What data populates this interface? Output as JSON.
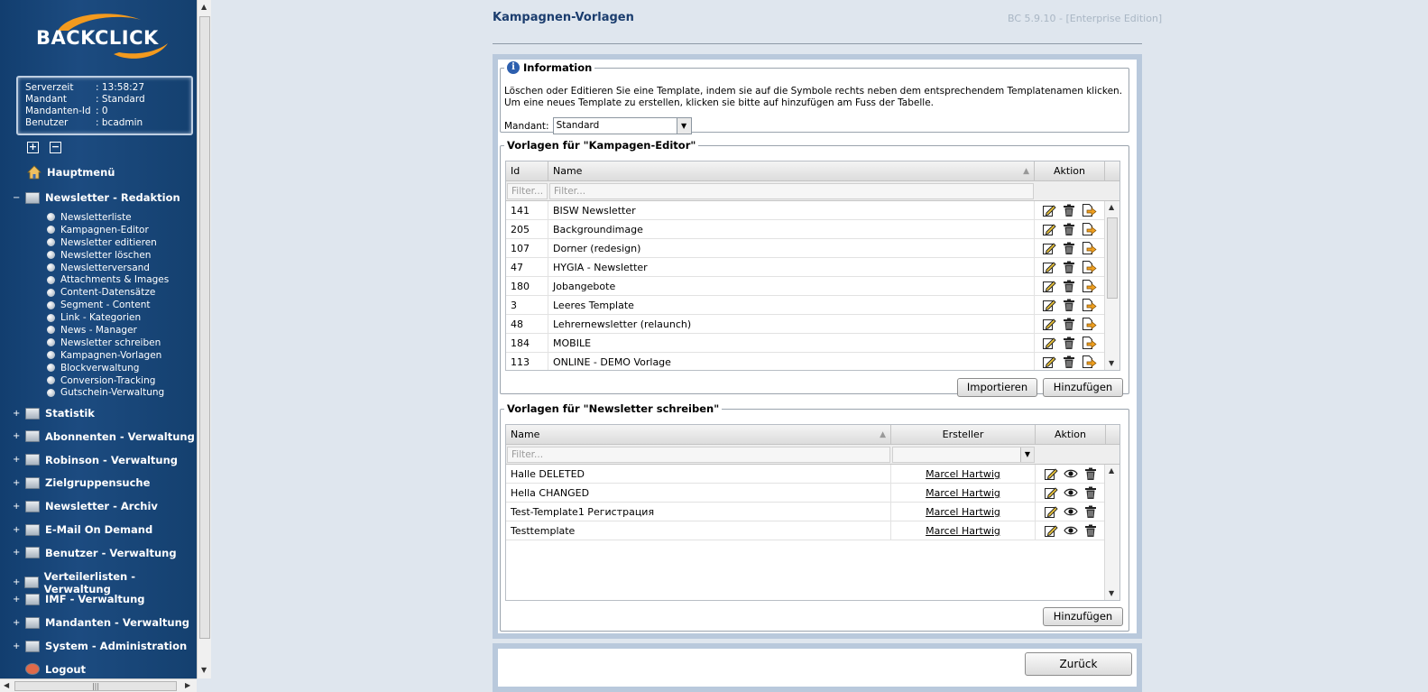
{
  "brand": {
    "logo_text": "BACKCLICK"
  },
  "server_info": [
    {
      "key": "Serverzeit",
      "value": ": 13:58:27"
    },
    {
      "key": "Mandant",
      "value": ": Standard"
    },
    {
      "key": "Mandanten-Id",
      "value": ": 0"
    },
    {
      "key": "Benutzer",
      "value": ": bcadmin"
    }
  ],
  "sidebar": {
    "expand_all": "+",
    "collapse_all": "−",
    "main_menu": "Hauptmenü",
    "open_section": {
      "toggle": "−",
      "label": "Newsletter - Redaktion"
    },
    "sub_items": [
      "Newsletterliste",
      "Kampagnen-Editor",
      "Newsletter editieren",
      "Newsletter löschen",
      "Newsletterversand",
      "Attachments & Images",
      "Content-Datensätze",
      "Segment - Content",
      "Link - Kategorien",
      "News - Manager",
      "Newsletter schreiben",
      "Kampagnen-Vorlagen",
      "Blockverwaltung",
      "Conversion-Tracking",
      "Gutschein-Verwaltung"
    ],
    "sections": [
      "Statistik",
      "Abonnenten - Verwaltung",
      "Robinson - Verwaltung",
      "Zielgruppensuche",
      "Newsletter - Archiv",
      "E-Mail On Demand",
      "Benutzer - Verwaltung",
      "Verteilerlisten - Verwaltung",
      "IMF - Verwaltung",
      "Mandanten - Verwaltung",
      "System - Administration",
      "Logout"
    ],
    "section_toggle": "+"
  },
  "header": {
    "title": "Kampagnen-Vorlagen",
    "version": "BC 5.9.10 - [Enterprise Edition]"
  },
  "information": {
    "legend": "Information",
    "icon_glyph": "i",
    "line1": "Löschen oder Editieren Sie eine Template, indem sie auf die Symbole rechts neben dem entsprechendem Templatenamen klicken.",
    "line2": "Um eine neues Template zu erstellen, klicken sie bitte auf hinzufügen am Fuss der Tabelle.",
    "mandant_label": "Mandant:",
    "mandant_value": "Standard"
  },
  "editor_templates": {
    "legend": "Vorlagen für \"Kampagen-Editor\"",
    "columns": {
      "id": "Id",
      "name": "Name",
      "action": "Aktion"
    },
    "filter_placeholder": "Filter...",
    "rows": [
      {
        "id": "141",
        "name": "BISW Newsletter"
      },
      {
        "id": "205",
        "name": "Backgroundimage"
      },
      {
        "id": "107",
        "name": "Dorner (redesign)"
      },
      {
        "id": "47",
        "name": "HYGIA - Newsletter"
      },
      {
        "id": "180",
        "name": "Jobangebote"
      },
      {
        "id": "3",
        "name": "Leeres Template"
      },
      {
        "id": "48",
        "name": "Lehrernewsletter (relaunch)"
      },
      {
        "id": "184",
        "name": "MOBILE"
      },
      {
        "id": "113",
        "name": "ONLINE - DEMO Vorlage"
      }
    ],
    "import_button": "Importieren",
    "add_button": "Hinzufügen"
  },
  "writer_templates": {
    "legend": "Vorlagen für \"Newsletter schreiben\"",
    "columns": {
      "name": "Name",
      "creator": "Ersteller",
      "action": "Aktion"
    },
    "filter_placeholder": "Filter...",
    "rows": [
      {
        "name": "Halle DELETED",
        "creator": "Marcel Hartwig"
      },
      {
        "name": "Hella CHANGED",
        "creator": "Marcel Hartwig"
      },
      {
        "name": "Test-Template1 Регистрация",
        "creator": "Marcel Hartwig"
      },
      {
        "name": "Testtemplate",
        "creator": "Marcel Hartwig"
      }
    ],
    "add_button": "Hinzufügen"
  },
  "footer": {
    "back_button": "Zurück"
  },
  "colors": {
    "sidebar": "#1c4b80",
    "title": "#1b3d6e",
    "panel_frame": "#b9c9dc",
    "background": "#dfe6ee"
  },
  "icons": {
    "edit": "edit-icon",
    "delete": "trash-icon",
    "export": "export-icon",
    "preview": "eye-icon"
  }
}
